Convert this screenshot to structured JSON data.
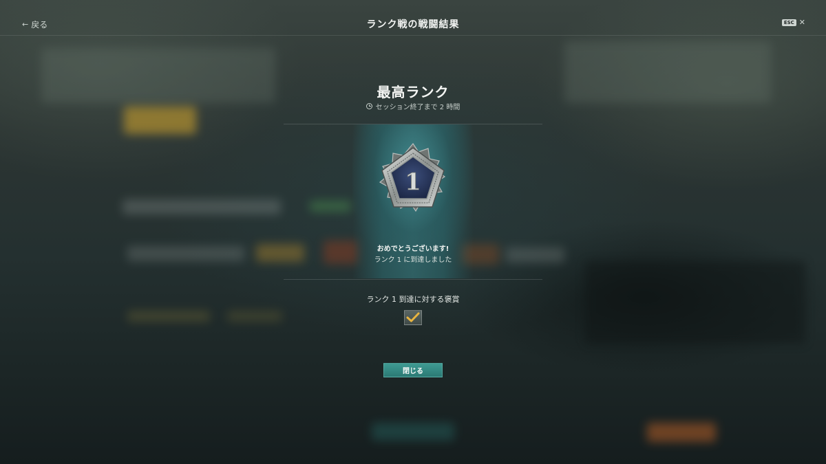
{
  "header": {
    "back_label": "戻る",
    "title": "ランク戦の戦闘結果",
    "esc_label": "ESC"
  },
  "main": {
    "rank_title": "最高ランク",
    "session_text": "セッション終了まで 2 時間",
    "rank_number": "1",
    "congrats": "おめでとうございます!",
    "reached_text": "ランク 1 に到達しました",
    "reward_label": "ランク 1 到達に対する褒賞",
    "reward_claimed": true,
    "close_label": "閉じる"
  },
  "colors": {
    "accent": "#2f847d",
    "reward_check": "#e8b440"
  },
  "icons": [
    "back-arrow-icon",
    "close-x-icon",
    "clock-icon",
    "checkmark-icon"
  ]
}
